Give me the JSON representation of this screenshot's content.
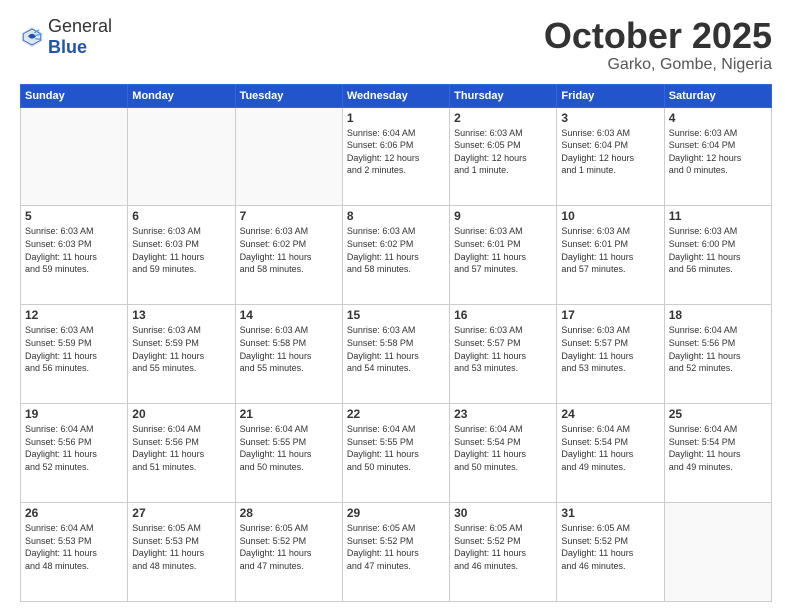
{
  "header": {
    "logo_general": "General",
    "logo_blue": "Blue",
    "month": "October 2025",
    "location": "Garko, Gombe, Nigeria"
  },
  "days_of_week": [
    "Sunday",
    "Monday",
    "Tuesday",
    "Wednesday",
    "Thursday",
    "Friday",
    "Saturday"
  ],
  "weeks": [
    [
      {
        "day": "",
        "text": ""
      },
      {
        "day": "",
        "text": ""
      },
      {
        "day": "",
        "text": ""
      },
      {
        "day": "1",
        "text": "Sunrise: 6:04 AM\nSunset: 6:06 PM\nDaylight: 12 hours\nand 2 minutes."
      },
      {
        "day": "2",
        "text": "Sunrise: 6:03 AM\nSunset: 6:05 PM\nDaylight: 12 hours\nand 1 minute."
      },
      {
        "day": "3",
        "text": "Sunrise: 6:03 AM\nSunset: 6:04 PM\nDaylight: 12 hours\nand 1 minute."
      },
      {
        "day": "4",
        "text": "Sunrise: 6:03 AM\nSunset: 6:04 PM\nDaylight: 12 hours\nand 0 minutes."
      }
    ],
    [
      {
        "day": "5",
        "text": "Sunrise: 6:03 AM\nSunset: 6:03 PM\nDaylight: 11 hours\nand 59 minutes."
      },
      {
        "day": "6",
        "text": "Sunrise: 6:03 AM\nSunset: 6:03 PM\nDaylight: 11 hours\nand 59 minutes."
      },
      {
        "day": "7",
        "text": "Sunrise: 6:03 AM\nSunset: 6:02 PM\nDaylight: 11 hours\nand 58 minutes."
      },
      {
        "day": "8",
        "text": "Sunrise: 6:03 AM\nSunset: 6:02 PM\nDaylight: 11 hours\nand 58 minutes."
      },
      {
        "day": "9",
        "text": "Sunrise: 6:03 AM\nSunset: 6:01 PM\nDaylight: 11 hours\nand 57 minutes."
      },
      {
        "day": "10",
        "text": "Sunrise: 6:03 AM\nSunset: 6:01 PM\nDaylight: 11 hours\nand 57 minutes."
      },
      {
        "day": "11",
        "text": "Sunrise: 6:03 AM\nSunset: 6:00 PM\nDaylight: 11 hours\nand 56 minutes."
      }
    ],
    [
      {
        "day": "12",
        "text": "Sunrise: 6:03 AM\nSunset: 5:59 PM\nDaylight: 11 hours\nand 56 minutes."
      },
      {
        "day": "13",
        "text": "Sunrise: 6:03 AM\nSunset: 5:59 PM\nDaylight: 11 hours\nand 55 minutes."
      },
      {
        "day": "14",
        "text": "Sunrise: 6:03 AM\nSunset: 5:58 PM\nDaylight: 11 hours\nand 55 minutes."
      },
      {
        "day": "15",
        "text": "Sunrise: 6:03 AM\nSunset: 5:58 PM\nDaylight: 11 hours\nand 54 minutes."
      },
      {
        "day": "16",
        "text": "Sunrise: 6:03 AM\nSunset: 5:57 PM\nDaylight: 11 hours\nand 53 minutes."
      },
      {
        "day": "17",
        "text": "Sunrise: 6:03 AM\nSunset: 5:57 PM\nDaylight: 11 hours\nand 53 minutes."
      },
      {
        "day": "18",
        "text": "Sunrise: 6:04 AM\nSunset: 5:56 PM\nDaylight: 11 hours\nand 52 minutes."
      }
    ],
    [
      {
        "day": "19",
        "text": "Sunrise: 6:04 AM\nSunset: 5:56 PM\nDaylight: 11 hours\nand 52 minutes."
      },
      {
        "day": "20",
        "text": "Sunrise: 6:04 AM\nSunset: 5:56 PM\nDaylight: 11 hours\nand 51 minutes."
      },
      {
        "day": "21",
        "text": "Sunrise: 6:04 AM\nSunset: 5:55 PM\nDaylight: 11 hours\nand 50 minutes."
      },
      {
        "day": "22",
        "text": "Sunrise: 6:04 AM\nSunset: 5:55 PM\nDaylight: 11 hours\nand 50 minutes."
      },
      {
        "day": "23",
        "text": "Sunrise: 6:04 AM\nSunset: 5:54 PM\nDaylight: 11 hours\nand 50 minutes."
      },
      {
        "day": "24",
        "text": "Sunrise: 6:04 AM\nSunset: 5:54 PM\nDaylight: 11 hours\nand 49 minutes."
      },
      {
        "day": "25",
        "text": "Sunrise: 6:04 AM\nSunset: 5:54 PM\nDaylight: 11 hours\nand 49 minutes."
      }
    ],
    [
      {
        "day": "26",
        "text": "Sunrise: 6:04 AM\nSunset: 5:53 PM\nDaylight: 11 hours\nand 48 minutes."
      },
      {
        "day": "27",
        "text": "Sunrise: 6:05 AM\nSunset: 5:53 PM\nDaylight: 11 hours\nand 48 minutes."
      },
      {
        "day": "28",
        "text": "Sunrise: 6:05 AM\nSunset: 5:52 PM\nDaylight: 11 hours\nand 47 minutes."
      },
      {
        "day": "29",
        "text": "Sunrise: 6:05 AM\nSunset: 5:52 PM\nDaylight: 11 hours\nand 47 minutes."
      },
      {
        "day": "30",
        "text": "Sunrise: 6:05 AM\nSunset: 5:52 PM\nDaylight: 11 hours\nand 46 minutes."
      },
      {
        "day": "31",
        "text": "Sunrise: 6:05 AM\nSunset: 5:52 PM\nDaylight: 11 hours\nand 46 minutes."
      },
      {
        "day": "",
        "text": ""
      }
    ]
  ]
}
